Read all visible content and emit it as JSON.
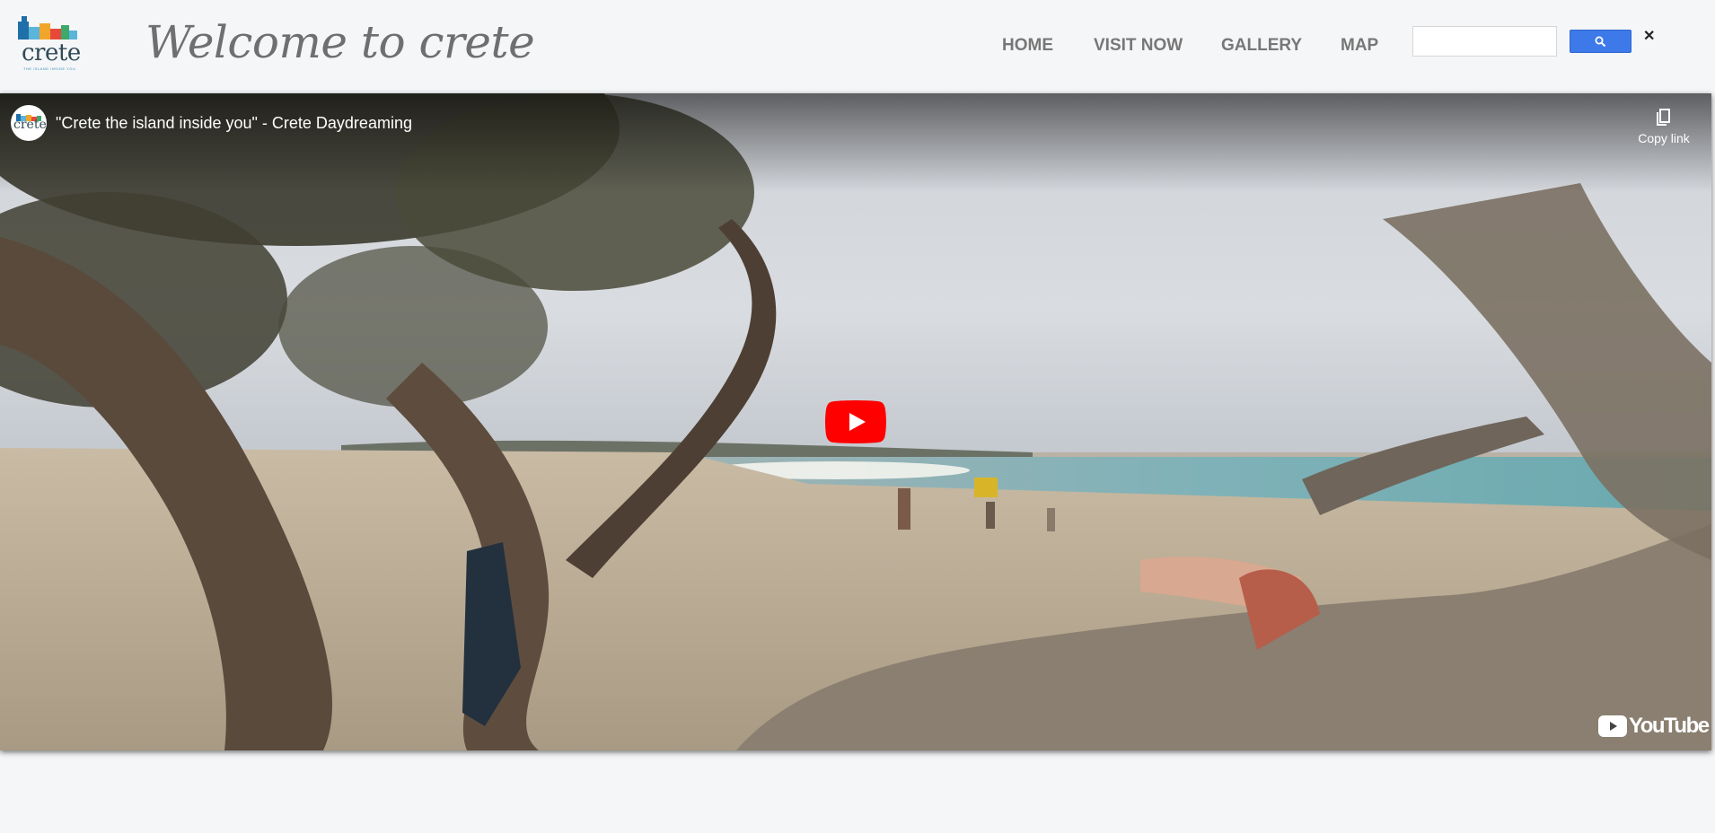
{
  "header": {
    "logo": {
      "word": "crete",
      "tagline": "THE ISLAND INSIDE YOU"
    },
    "title": "Welcome to crete",
    "nav": [
      {
        "label": "HOME"
      },
      {
        "label": "VISIT NOW"
      },
      {
        "label": "GALLERY"
      },
      {
        "label": "MAP"
      }
    ],
    "search": {
      "value": "",
      "placeholder": "",
      "button_icon": "search-icon",
      "clear_icon": "close-icon",
      "clear_glyph": "✕"
    }
  },
  "video": {
    "channel_avatar_word": "crete",
    "title": "\"Crete the island inside you\" - Crete Daydreaming",
    "copy_link_label": "Copy link",
    "copy_icon": "copy-icon",
    "play_icon": "play-icon",
    "youtube_logo_text": "YouTube"
  },
  "colors": {
    "header_bg": "#f5f6f8",
    "nav_text": "#777777",
    "search_button": "#3d79e9",
    "play_red": "#ff0000"
  }
}
